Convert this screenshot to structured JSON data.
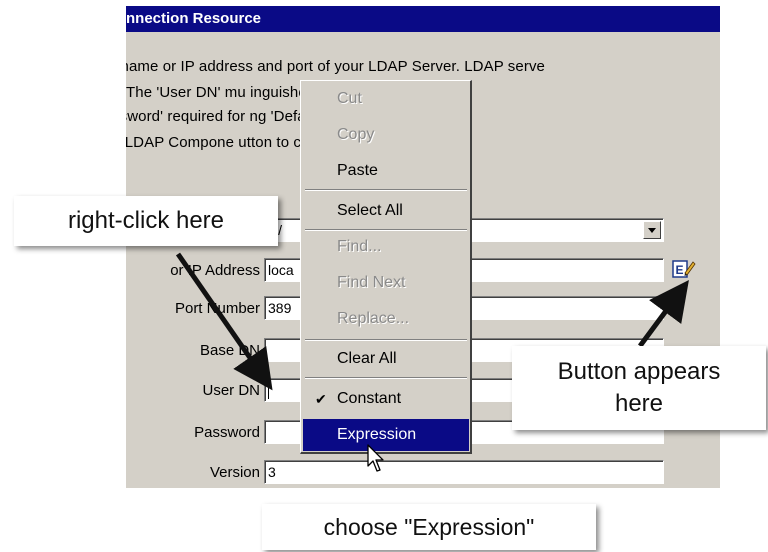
{
  "dialog": {
    "title": "nnection Resource",
    "description_lines": [
      "t name or IP address and port of your LDAP Server.  LDAP serve",
      "  The 'User DN' mu                        inguished name, such as",
      "ssword' required for                      ng 'Default' makes this Cor",
      "a LDAP Compone                          utton to check your connec"
    ]
  },
  "form": {
    "dropdown_value": "D/",
    "host_label": "or IP Address",
    "host_value": "loca",
    "port_label": "Port Number",
    "port_value": "389",
    "basedn_label": "Base DN",
    "basedn_value": "",
    "userdn_label": "User DN",
    "userdn_value": "",
    "password_label": "Password",
    "password_value": "",
    "version_label": "Version",
    "version_value": "3"
  },
  "context_menu": {
    "items": [
      {
        "label": "Cut",
        "enabled": false
      },
      {
        "label": "Copy",
        "enabled": false
      },
      {
        "label": "Paste",
        "enabled": true
      },
      {
        "label": "Select All",
        "enabled": true
      },
      {
        "label": "Find...",
        "enabled": false
      },
      {
        "label": "Find Next",
        "enabled": false
      },
      {
        "label": "Replace...",
        "enabled": false
      },
      {
        "label": "Clear All",
        "enabled": true
      },
      {
        "label": "Constant",
        "enabled": true,
        "checked": true
      },
      {
        "label": "Expression",
        "enabled": true,
        "selected": true
      }
    ],
    "check_glyph": "✔"
  },
  "callouts": {
    "right_click": "right-click here",
    "button_appears_line1": "Button appears",
    "button_appears_line2": "here",
    "choose_expression": "choose \"Expression\""
  },
  "colors": {
    "titlebar": "#0a0a86",
    "face": "#d4d0c8",
    "selection": "#0a0a86"
  }
}
